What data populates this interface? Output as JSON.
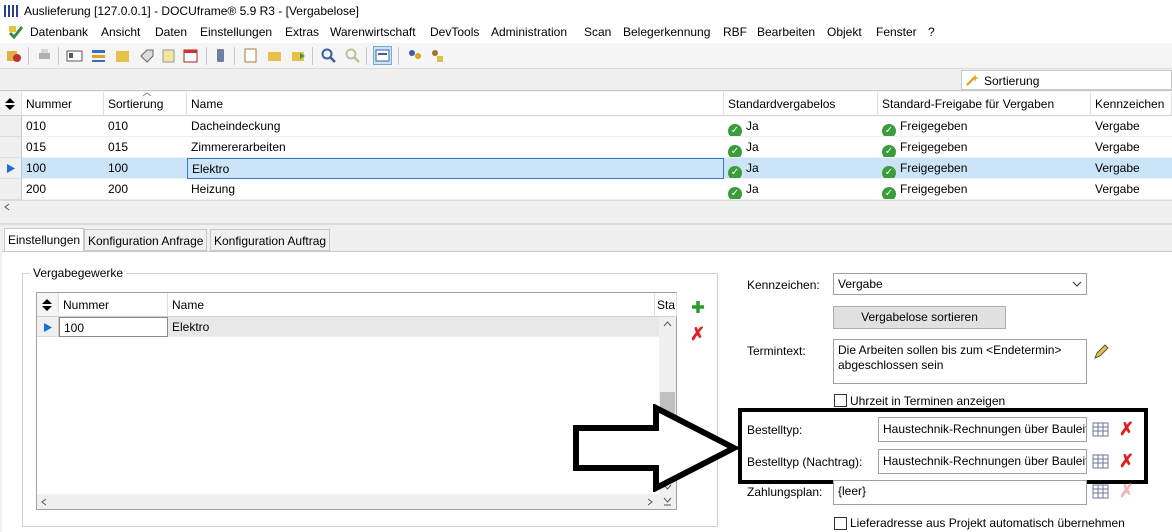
{
  "window": {
    "title": "Auslieferung [127.0.0.1] - DOCUframe® 5.9 R3 - [Vergabelose]"
  },
  "menu": [
    "Datenbank",
    "Ansicht",
    "Daten",
    "Einstellungen",
    "Extras",
    "Warenwirtschaft",
    "DevTools",
    "Administration",
    "Scan",
    "Belegerkennung",
    "RBF",
    "Bearbeiten",
    "Objekt",
    "Fenster",
    "?"
  ],
  "sortbar": {
    "label": "Sortierung"
  },
  "grid": {
    "columns": [
      "Nummer",
      "Sortierung",
      "Name",
      "Standardvergabelos",
      "Standard-Freigabe für Vergaben",
      "Kennzeichen"
    ],
    "rows": [
      {
        "nummer": "010",
        "sort": "010",
        "name": "Dacheindeckung",
        "std": "Ja",
        "freigabe": "Freigegeben",
        "kz": "Vergabe"
      },
      {
        "nummer": "015",
        "sort": "015",
        "name": "Zimmererarbeiten",
        "std": "Ja",
        "freigabe": "Freigegeben",
        "kz": "Vergabe"
      },
      {
        "nummer": "100",
        "sort": "100",
        "name": "Elektro",
        "std": "Ja",
        "freigabe": "Freigegeben",
        "kz": "Vergabe"
      },
      {
        "nummer": "200",
        "sort": "200",
        "name": "Heizung",
        "std": "Ja",
        "freigabe": "Freigegeben",
        "kz": "Vergabe"
      }
    ],
    "selected_row": 2
  },
  "tabs": [
    "Einstellungen",
    "Konfiguration Anfrage",
    "Konfiguration Auftrag"
  ],
  "group": {
    "title": "Vergabegewerke",
    "columns": [
      "Nummer",
      "Name",
      "Sta"
    ],
    "rows": [
      {
        "nummer": "100",
        "name": "Elektro"
      }
    ]
  },
  "form": {
    "kennzeichen_label": "Kennzeichen:",
    "kennzeichen_value": "Vergabe",
    "sort_button": "Vergabelose sortieren",
    "termintext_label": "Termintext:",
    "termintext_value": "Die Arbeiten sollen bis zum <Endetermin> abgeschlossen sein",
    "uhrzeit_label": "Uhrzeit in Terminen anzeigen",
    "bestelltyp_label": "Bestelltyp:",
    "bestelltyp_value": "Haustechnik-Rechnungen über Bauleit",
    "bestelltyp_nachtrag_label": "Bestelltyp (Nachtrag):",
    "bestelltyp_nachtrag_value": "Haustechnik-Rechnungen über Bauleit",
    "zahlungsplan_label": "Zahlungsplan:",
    "zahlungsplan_value": "{leer}",
    "lieferadresse_label": "Lieferadresse aus Projekt automatisch übernehmen"
  }
}
